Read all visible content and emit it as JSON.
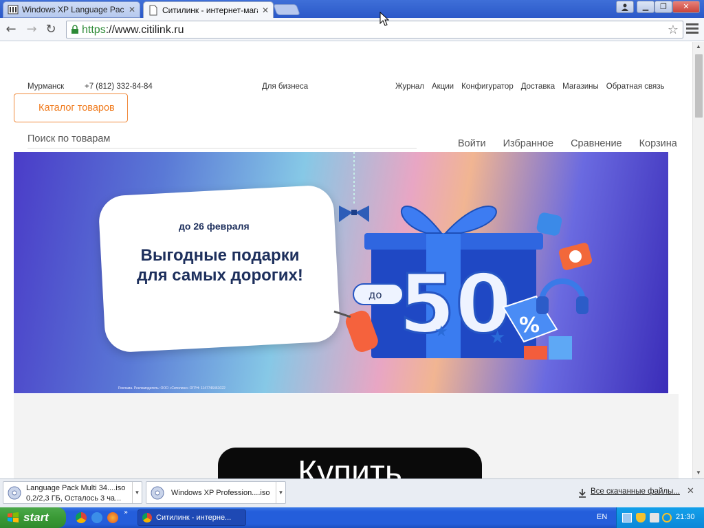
{
  "browser": {
    "tabs": [
      {
        "label": "Windows XP Language Pack",
        "active": false,
        "icon": "archive-icon"
      },
      {
        "label": "Ситилинк - интернет-магаз",
        "active": true,
        "icon": "page-icon"
      }
    ],
    "url_scheme": "https",
    "url_rest": "://www.citilink.ru"
  },
  "site": {
    "city": "Мурманск",
    "phone": "+7 (812) 332-84-84",
    "business": "Для бизнеса",
    "top_links": [
      "Журнал",
      "Акции",
      "Конфигуратор",
      "Доставка",
      "Магазины",
      "Обратная связь"
    ],
    "catalog_button": "Каталог товаров",
    "search_placeholder": "Поиск по товарам",
    "user_links": [
      "Войти",
      "Избранное",
      "Сравнение",
      "Корзина"
    ],
    "banner": {
      "date": "до 26 февраля",
      "headline_1": "Выгодные подарки",
      "headline_2": "для самых дорогих!",
      "badge_prefix": "до",
      "badge_number": "50",
      "badge_percent": "%",
      "legal": "Реклама. Рекламодатель: ООО «Ситилинк» ОГРН: 1147746461022"
    },
    "buy_button": "Купить"
  },
  "downloads": {
    "items": [
      {
        "name": "Language Pack Multi 34....iso",
        "status": "0,2/2,3 ГБ, Осталось 3 ча..."
      },
      {
        "name": "Windows XP Profession....iso",
        "status": ""
      }
    ],
    "all_link": "Все скачанные файлы..."
  },
  "taskbar": {
    "start": "start",
    "task_label": "Ситилинк - интерне...",
    "language": "EN",
    "clock": "21:30"
  }
}
